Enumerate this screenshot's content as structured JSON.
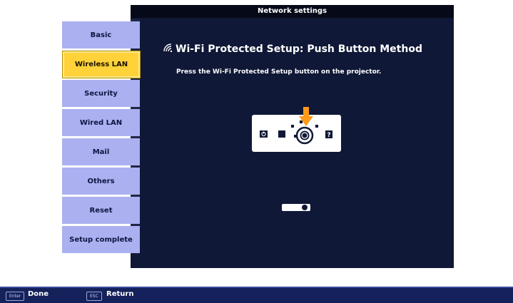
{
  "window": {
    "title": "Network settings"
  },
  "menu": {
    "items": [
      {
        "label": "Basic",
        "active": false
      },
      {
        "label": "Wireless LAN",
        "active": true
      },
      {
        "label": "Security",
        "active": false
      },
      {
        "label": "Wired LAN",
        "active": false
      },
      {
        "label": "Mail",
        "active": false
      },
      {
        "label": "Others",
        "active": false
      },
      {
        "label": "Reset",
        "active": false
      },
      {
        "label": "Setup complete",
        "active": false
      }
    ]
  },
  "main": {
    "heading": "Wi-Fi Protected Setup: Push Button Method",
    "instruction": "Press the Wi-Fi Protected Setup button on the projector.",
    "icons": [
      "wifi-icon",
      "power-icon",
      "wps-button-icon",
      "help-icon",
      "arrow-down-icon"
    ]
  },
  "footer": {
    "enter_key": "Enter",
    "enter_label": "Done",
    "esc_key": "ESC",
    "esc_label": "Return"
  },
  "colors": {
    "panel": "#0f1836",
    "menu_item": "#aab0f0",
    "menu_active": "#ffd23a",
    "accent_arrow": "#ff9a1a",
    "footer": "#14215a"
  }
}
